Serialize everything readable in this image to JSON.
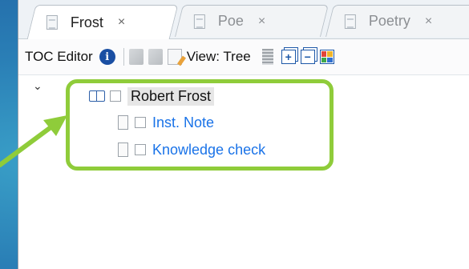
{
  "tabs": [
    {
      "label": "Frost",
      "close": "×",
      "active": true
    },
    {
      "label": "Poe",
      "close": "×",
      "active": false
    },
    {
      "label": "Poetry",
      "close": "×",
      "active": false
    }
  ],
  "toolbar": {
    "title": "TOC Editor",
    "view_label": "View: Tree"
  },
  "tree": {
    "root": {
      "label": "Robert Frost",
      "expanded": true
    },
    "children": [
      {
        "label": "Inst. Note"
      },
      {
        "label": "Knowledge check"
      }
    ]
  },
  "colors": {
    "highlight": "#8fcc3a",
    "link": "#1a73e8",
    "background": "#2f7fb1"
  }
}
